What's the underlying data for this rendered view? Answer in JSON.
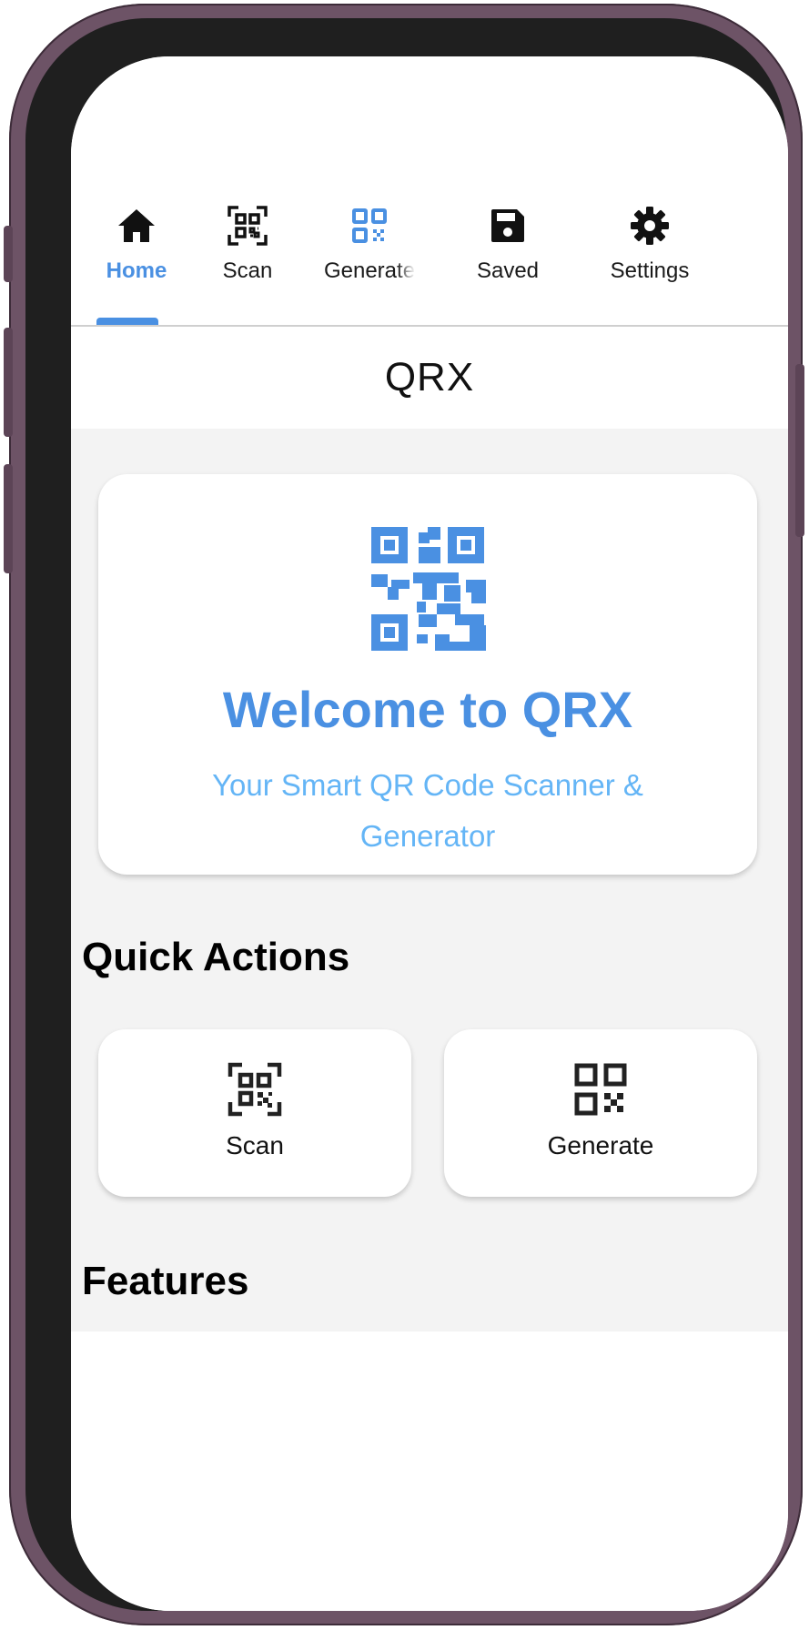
{
  "tabs": [
    {
      "label": "Home",
      "icon": "home-icon",
      "active": true
    },
    {
      "label": "Scan",
      "icon": "qr-scan-icon",
      "active": false
    },
    {
      "label": "Generate",
      "icon": "qr-code-icon",
      "active": false
    },
    {
      "label": "Saved",
      "icon": "save-icon",
      "active": false
    },
    {
      "label": "Settings",
      "icon": "gear-icon",
      "active": false
    }
  ],
  "header": {
    "title": "QRX"
  },
  "hero": {
    "icon": "qr-code-icon",
    "title": "Welcome to QRX",
    "subtitle": "Your Smart QR Code Scanner & Generator"
  },
  "quick_actions": {
    "title": "Quick Actions",
    "items": [
      {
        "label": "Scan",
        "icon": "qr-scan-icon"
      },
      {
        "label": "Generate",
        "icon": "qr-code-icon"
      }
    ]
  },
  "features": {
    "title": "Features"
  },
  "colors": {
    "accent": "#4a90e2",
    "accent_light": "#64b5f6",
    "background": "#f3f3f3",
    "frame": "#6d5366"
  }
}
